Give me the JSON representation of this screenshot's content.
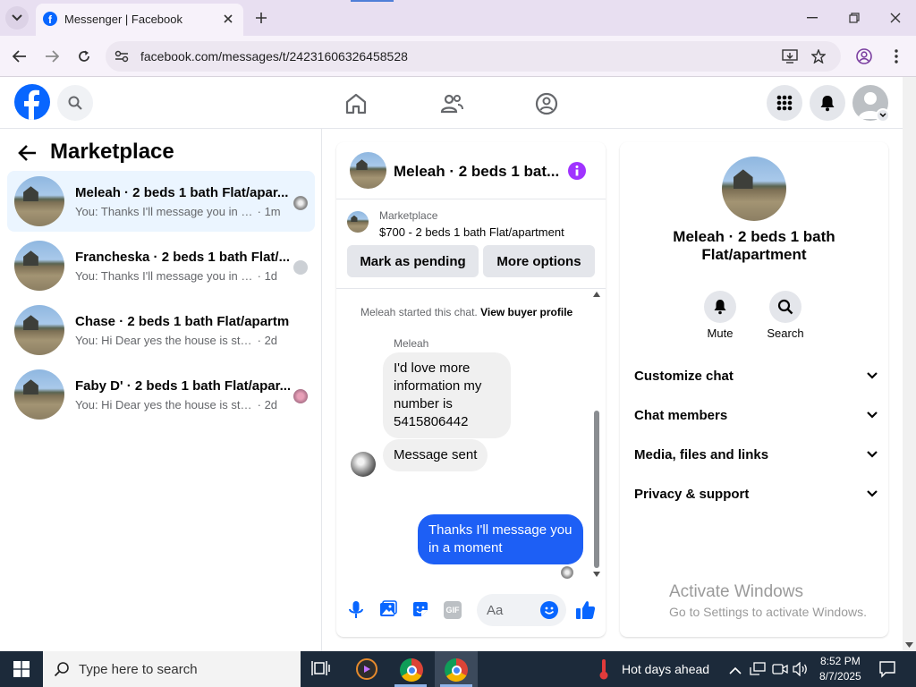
{
  "browser": {
    "tab_title": "Messenger | Facebook",
    "url": "facebook.com/messages/t/24231606326458528"
  },
  "marketplace": {
    "title": "Marketplace",
    "conversations": [
      {
        "title": "Meleah · 2 beds 1 bath Flat/apar...",
        "preview": "You: Thanks I'll message you in a ...",
        "time": "· 1m"
      },
      {
        "title": "Francheska · 2 beds 1 bath Flat/...",
        "preview": "You: Thanks I'll message you in a ...",
        "time": "· 1d"
      },
      {
        "title": "Chase · 2 beds 1 bath Flat/apartme...",
        "preview": "You: Hi Dear yes the house is still avail...",
        "time": "· 2d"
      },
      {
        "title": "Faby D' · 2 beds 1 bath Flat/apar...",
        "preview": "You: Hi Dear yes the house is still a...",
        "time": "· 2d"
      }
    ]
  },
  "chat": {
    "header_title": "Meleah · 2 beds 1 bat...",
    "listing_source": "Marketplace",
    "listing_text": "$700 - 2 beds 1 bath Flat/apartment",
    "mark_pending": "Mark as pending",
    "more_options": "More options",
    "started_note": "Meleah started this chat.",
    "view_profile": "View buyer profile",
    "sender_name": "Meleah",
    "msg1": "I'd love more information my number is 5415806442",
    "msg2": "Message sent",
    "msg3": "Thanks I'll message you in a moment",
    "composer_placeholder": "Aa"
  },
  "details": {
    "title": "Meleah · 2 beds 1 bath Flat/apartment",
    "mute_label": "Mute",
    "search_label": "Search",
    "sections": [
      "Customize chat",
      "Chat members",
      "Media, files and links",
      "Privacy & support"
    ]
  },
  "watermark": {
    "line1": "Activate Windows",
    "line2": "Go to Settings to activate Windows."
  },
  "taskbar": {
    "search_placeholder": "Type here to search",
    "weather": "Hot days ahead",
    "time": "8:52 PM",
    "date": "8/7/2025"
  },
  "colors": {
    "fb_blue": "#0866ff",
    "outgoing_bubble": "#1d5ff5",
    "info_purple": "#a033ff"
  }
}
